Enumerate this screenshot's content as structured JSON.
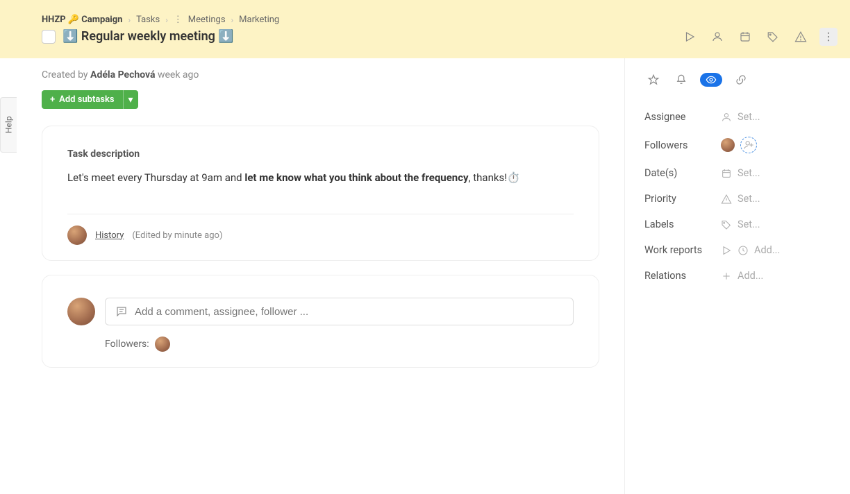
{
  "breadcrumb": {
    "project_prefix": "HHZP",
    "project_emoji": "🔑",
    "project": "Campaign",
    "level1": "Tasks",
    "level2": "Meetings",
    "level3": "Marketing"
  },
  "task": {
    "title": "⬇️ Regular weekly meeting ⬇️",
    "created_by_label": "Created by",
    "author": "Adéla Pechová",
    "created_time": "week ago"
  },
  "buttons": {
    "add_subtasks": "Add subtasks",
    "plus": "+",
    "caret": "▾"
  },
  "description": {
    "heading": "Task description",
    "text_pre": "Let's meet every Thursday at 9am and ",
    "text_bold": "let me know what you think about the frequency",
    "text_post": ", thanks!⏱️",
    "history_label": "History",
    "edited_label": "(Edited by minute ago)"
  },
  "comment": {
    "placeholder": "Add a comment, assignee, follower ...",
    "followers_label": "Followers:"
  },
  "sidebar": {
    "assignee": {
      "label": "Assignee",
      "value": "Set..."
    },
    "followers": {
      "label": "Followers"
    },
    "dates": {
      "label": "Date(s)",
      "value": "Set..."
    },
    "priority": {
      "label": "Priority",
      "value": "Set..."
    },
    "labels": {
      "label": "Labels",
      "value": "Set..."
    },
    "work_reports": {
      "label": "Work reports",
      "value": "Add..."
    },
    "relations": {
      "label": "Relations",
      "value": "Add..."
    }
  },
  "help_tab": "Help"
}
